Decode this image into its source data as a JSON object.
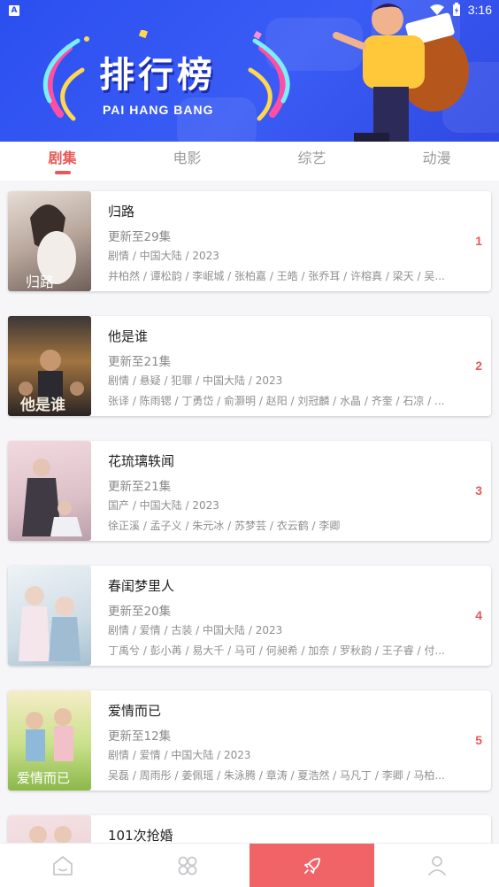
{
  "status_bar": {
    "time": "3:16",
    "app_badge": "A"
  },
  "banner": {
    "title": "排行榜",
    "subtitle": "PAI HANG BANG"
  },
  "tabs": [
    {
      "label": "剧集",
      "active": true
    },
    {
      "label": "电影",
      "active": false
    },
    {
      "label": "综艺",
      "active": false
    },
    {
      "label": "动漫",
      "active": false
    }
  ],
  "items": [
    {
      "name": "归路",
      "update": "更新至29集",
      "genre": "剧情 / 中国大陆 / 2023",
      "cast": "井柏然 / 谭松韵 / 李岷城 / 张柏嘉 / 王皓 / 张乔耳 / 许榕真 / 梁天 / 吴...",
      "rank": "1",
      "poster_colors": [
        "#d9cfc8",
        "#8e7f78"
      ]
    },
    {
      "name": "他是谁",
      "update": "更新至21集",
      "genre": "剧情 / 悬疑 / 犯罪 / 中国大陆 / 2023",
      "cast": "张译 / 陈雨锶 / 丁勇岱 / 俞灏明 / 赵阳 / 刘冠麟 / 水晶 / 齐奎 / 石凉 / ...",
      "rank": "2",
      "poster_colors": [
        "#2c2a2c",
        "#c08a48"
      ]
    },
    {
      "name": "花琉璃轶闻",
      "update": "更新至21集",
      "genre": "国产 / 中国大陆 / 2023",
      "cast": "徐正溪 / 孟子义 / 朱元冰 / 苏梦芸 / 衣云鹤 / 李卿",
      "rank": "3",
      "poster_colors": [
        "#e9c9d0",
        "#5b4a52"
      ]
    },
    {
      "name": "春闺梦里人",
      "update": "更新至20集",
      "genre": "剧情 / 爱情 / 古装 / 中国大陆 / 2023",
      "cast": "丁禹兮 / 彭小苒 / 易大千 / 马可 / 何昶希 / 加奈 / 罗秋韵 / 王子睿 / 付...",
      "rank": "4",
      "poster_colors": [
        "#eaf0f4",
        "#9ab7c9"
      ]
    },
    {
      "name": "爱情而已",
      "update": "更新至12集",
      "genre": "剧情 / 爱情 / 中国大陆 / 2023",
      "cast": "吴磊 / 周雨彤 / 姜佩瑶 / 朱泳腾 / 章涛 / 夏浩然 / 马凡丁 / 李卿 / 马柏...",
      "rank": "5",
      "poster_colors": [
        "#b9d97a",
        "#f3e6b0"
      ]
    },
    {
      "name": "101次抢婚",
      "update": "",
      "genre": "",
      "cast": "",
      "rank": "",
      "poster_colors": [
        "#f1d9dc",
        "#6b5f7a"
      ]
    }
  ],
  "bottom_nav": [
    {
      "icon": "home-icon",
      "active": false
    },
    {
      "icon": "grid-icon",
      "active": false
    },
    {
      "icon": "rocket-icon",
      "active": true
    },
    {
      "icon": "user-icon",
      "active": false
    }
  ],
  "colors": {
    "accent": "#e85a5a",
    "banner": "#2b4ff0",
    "nav_active": "#f06467"
  }
}
